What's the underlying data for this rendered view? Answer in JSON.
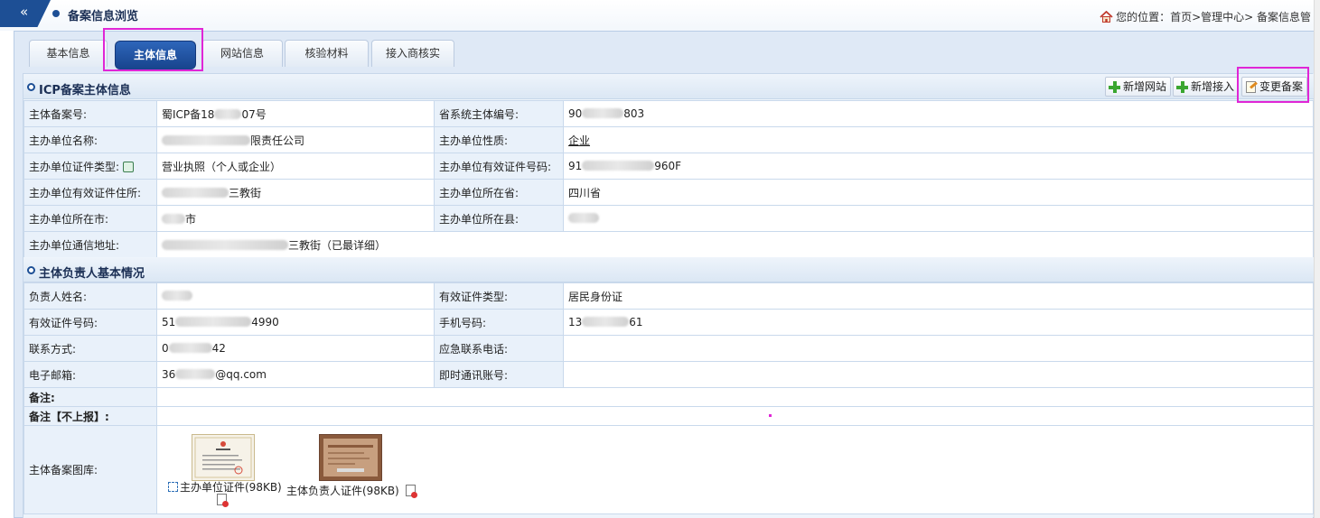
{
  "header": {
    "collapse_glyph": "«",
    "title": "备案信息浏览",
    "breadcrumb": "您的位置：首页>管理中心> 备案信息管"
  },
  "tabs": [
    {
      "label": "基本信息",
      "active": false
    },
    {
      "label": "主体信息",
      "active": true
    },
    {
      "label": "网站信息",
      "active": false
    },
    {
      "label": "核验材料",
      "active": false
    },
    {
      "label": "接入商核实",
      "active": false
    }
  ],
  "section_icp": {
    "title": "ICP备案主体信息",
    "buttons": {
      "add_site": "新增网站",
      "add_access": "新增接入",
      "change_filing": "变更备案"
    },
    "rows": [
      {
        "k1": "主体备案号:",
        "v1a": "蜀ICP备18",
        "v1b": "07号",
        "k2": "省系统主体编号:",
        "v2a": "90",
        "v2b": "803"
      },
      {
        "k1": "主办单位名称:",
        "v1b": "限责任公司",
        "k2": "主办单位性质:",
        "v2": "企业"
      },
      {
        "k1": "主办单位证件类型:",
        "v1": "营业执照（个人或企业）",
        "k2": "主办单位有效证件号码:",
        "v2a": "91",
        "v2b": "960F"
      },
      {
        "k1": "主办单位有效证件住所:",
        "v1b": "三教街",
        "k2": "主办单位所在省:",
        "v2": "四川省"
      },
      {
        "k1": "主办单位所在市:",
        "v1b": "市",
        "k2": "主办单位所在县:"
      },
      {
        "k1": "主办单位通信地址:",
        "v1b": "三教街（已最详细）"
      }
    ]
  },
  "section_person": {
    "title": "主体负责人基本情况",
    "rows": [
      {
        "k1": "负责人姓名:",
        "k2": "有效证件类型:",
        "v2": "居民身份证"
      },
      {
        "k1": "有效证件号码:",
        "v1a": "51",
        "v1b": "4990",
        "k2": "手机号码:",
        "v2a": "13",
        "v2b": "61"
      },
      {
        "k1": "联系方式:",
        "v1a": "0",
        "v1b": "42",
        "k2": "应急联系电话:"
      },
      {
        "k1": "电子邮箱:",
        "v1a": "36",
        "v1b": "@qq.com",
        "k2": "即时通讯账号:"
      },
      {
        "k1": "备注:"
      },
      {
        "k1": "备注【不上报】:"
      },
      {
        "k1": "主体备案图库:"
      }
    ],
    "gallery": [
      {
        "caption": "主办单位证件(98KB)"
      },
      {
        "caption": "主体负责人证件(98KB)"
      }
    ]
  },
  "colors": {
    "brand_blue": "#1d4f95",
    "highlight": "#e026d6",
    "add_green": "#3aa630"
  },
  "icons": [
    "collapse-icon",
    "home-icon",
    "bullet-icon",
    "add-icon",
    "edit-icon",
    "certificate-icon",
    "zoom-icon",
    "document-icon"
  ]
}
